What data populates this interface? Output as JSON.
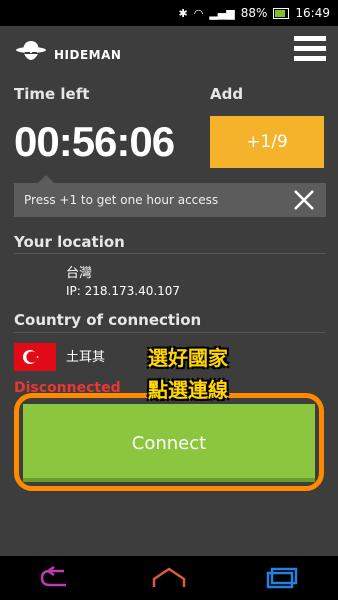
{
  "status_bar": {
    "battery": "88%",
    "time": "16:49"
  },
  "header": {
    "app_name": "HIDEMAN"
  },
  "time_left": {
    "label": "Time left",
    "value": "00:56:06"
  },
  "add": {
    "label": "Add",
    "button": "+1/9"
  },
  "tip": {
    "text": "Press +1 to get one hour access"
  },
  "location": {
    "label": "Your location",
    "country": "台灣",
    "ip": "IP: 218.173.40.107"
  },
  "connection": {
    "label": "Country of connection",
    "country": "土耳其",
    "status": "Disconnected",
    "button": "Connect"
  },
  "annotation": {
    "line1": "選好國家",
    "line2": "點選連線"
  },
  "colors": {
    "accent_orange": "#f5b22b",
    "connect_green": "#8cc63e",
    "highlight": "#ff8a00",
    "error": "#e53935"
  }
}
